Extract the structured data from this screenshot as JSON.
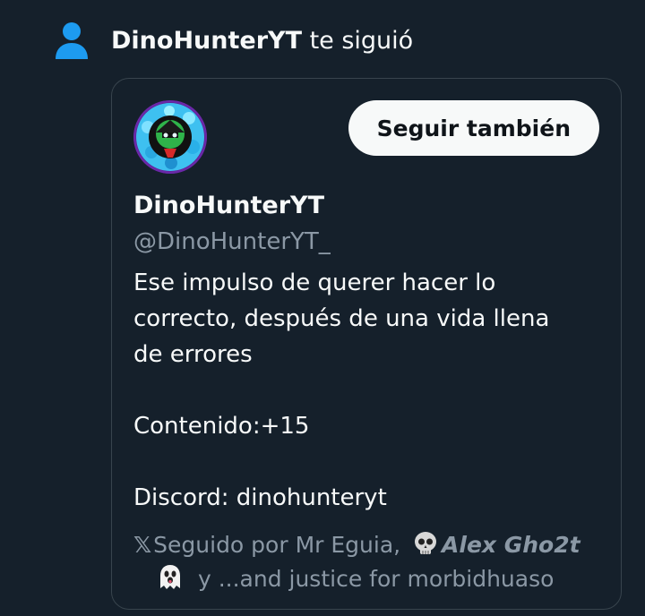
{
  "notification": {
    "actor_name": "DinoHunterYT",
    "action_text": " te siguió"
  },
  "profile": {
    "display_name": "DinoHunterYT",
    "handle": "@DinoHunterYT_",
    "follow_button_label": "Seguir también",
    "bio_lines": [
      "Ese impulso de querer hacer lo",
      "correcto, después de una vida llena",
      "de errores",
      "Contenido:+15",
      "Discord: dinohunteryt"
    ]
  },
  "followed_by": {
    "x_logo": "𝕏",
    "prefix": "Seguido por Mr Eguia, ",
    "second_follower": "Alex Gho2t",
    "suffix": " y ...and justice for morbidhuaso"
  },
  "colors": {
    "background": "#15202b",
    "accent_blue": "#1d9bf0",
    "secondary_text": "#8b98a5",
    "border": "#38444d"
  },
  "icons": [
    "person-icon",
    "skull-emoji",
    "ghost-emoji"
  ]
}
